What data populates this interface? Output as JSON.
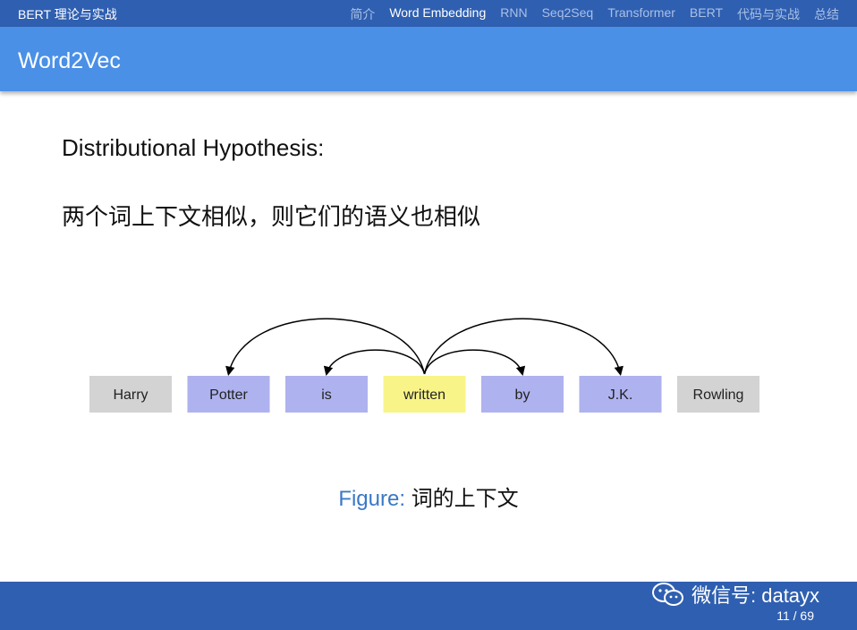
{
  "header": {
    "doc_title": "BERT 理论与实战",
    "nav_items": [
      "简介",
      "Word Embedding",
      "RNN",
      "Seq2Seq",
      "Transformer",
      "BERT",
      "代码与实战",
      "总结"
    ],
    "active_index": 1
  },
  "frame": {
    "title": "Word2Vec"
  },
  "content": {
    "line1": "Distributional Hypothesis:",
    "line2": "两个词上下文相似，则它们的语义也相似"
  },
  "diagram": {
    "words": [
      {
        "text": "Harry",
        "role": "outside",
        "color": "#d3d3d3"
      },
      {
        "text": "Potter",
        "role": "context",
        "color": "#aeb2ee"
      },
      {
        "text": "is",
        "role": "context",
        "color": "#aeb2ee"
      },
      {
        "text": "written",
        "role": "center",
        "color": "#f8f488"
      },
      {
        "text": "by",
        "role": "context",
        "color": "#aeb2ee"
      },
      {
        "text": "J.K.",
        "role": "context",
        "color": "#aeb2ee"
      },
      {
        "text": "Rowling",
        "role": "outside",
        "color": "#d3d3d3"
      }
    ],
    "arrows_from": "written",
    "arrows_to": [
      "Potter",
      "is",
      "by",
      "J.K."
    ]
  },
  "caption": {
    "label": "Figure:",
    "text": "词的上下文"
  },
  "footer": {
    "wechat_icon": "wechat-icon",
    "wechat_text": "微信号: datayx",
    "page_number": "11 / 69"
  },
  "colors": {
    "nav_bar": "#2f5fb0",
    "title_bar": "#4a90e6",
    "caption_label": "#3a78c6"
  }
}
